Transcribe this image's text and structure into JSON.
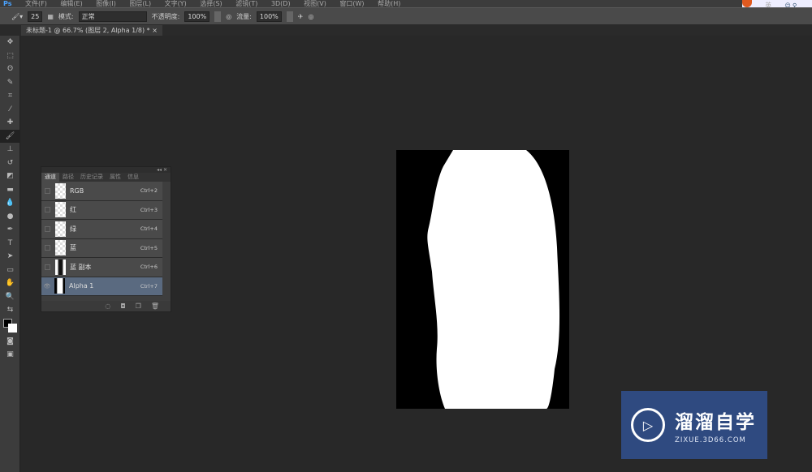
{
  "app": {
    "logo": "Ps"
  },
  "menu": [
    "文件(F)",
    "编辑(E)",
    "图像(I)",
    "图层(L)",
    "文字(Y)",
    "选择(S)",
    "滤镜(T)",
    "3D(D)",
    "视图(V)",
    "窗口(W)",
    "帮助(H)"
  ],
  "ime": {
    "label": "英"
  },
  "options": {
    "brush_size": "25",
    "mode_label": "模式:",
    "mode_value": "正常",
    "opacity_label": "不透明度:",
    "opacity_value": "100%",
    "flow_label": "流量:",
    "flow_value": "100%"
  },
  "document_tab": {
    "title": "未标题-1 @ 66.7% (图层 2, Alpha 1/8) *",
    "close": "×"
  },
  "channels_panel": {
    "tabs": [
      "通道",
      "路径",
      "历史记录",
      "属性",
      "信息"
    ],
    "channels": [
      {
        "name": "RGB",
        "shortcut": "Ctrl+2"
      },
      {
        "name": "红",
        "shortcut": "Ctrl+3"
      },
      {
        "name": "绿",
        "shortcut": "Ctrl+4"
      },
      {
        "name": "蓝",
        "shortcut": "Ctrl+5"
      },
      {
        "name": "蓝 副本",
        "shortcut": "Ctrl+6"
      },
      {
        "name": "Alpha 1",
        "shortcut": "Ctrl+7"
      }
    ]
  },
  "watermark": {
    "title": "溜溜自学",
    "url": "ZIXUE.3D66.COM"
  }
}
